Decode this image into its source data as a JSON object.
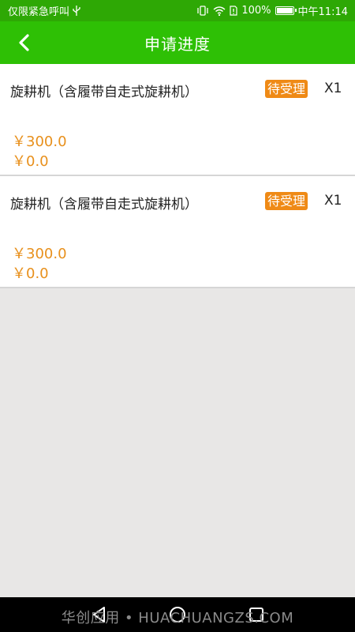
{
  "status_bar": {
    "left_text": "仅限紧急呼叫",
    "battery": "100%",
    "time": "中午11:14"
  },
  "app_bar": {
    "title": "申请进度"
  },
  "applications": [
    {
      "name": "旋耕机（含履带自走式旋耕机）",
      "status": "待受理",
      "quantity": "X1",
      "price": "￥300.0",
      "subsidy": "￥0.0"
    },
    {
      "name": "旋耕机（含履带自走式旋耕机）",
      "status": "待受理",
      "quantity": "X1",
      "price": "￥300.0",
      "subsidy": "￥0.0"
    }
  ],
  "watermark": "华创应用 • HUACHUANGZS.COM",
  "colors": {
    "header": "#2ec005",
    "status_badge": "#ef8a16",
    "price": "#e8901c"
  }
}
